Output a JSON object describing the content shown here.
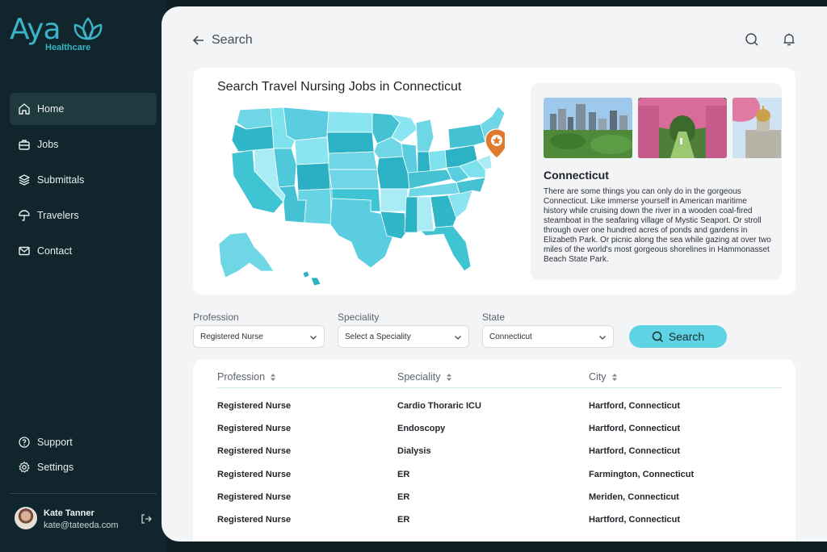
{
  "brand": {
    "name": "Aya",
    "sub": "Healthcare"
  },
  "sidebar": {
    "items": [
      {
        "label": "Home",
        "icon": "home-icon",
        "active": true
      },
      {
        "label": "Jobs",
        "icon": "briefcase-icon"
      },
      {
        "label": "Submittals",
        "icon": "layers-icon"
      },
      {
        "label": "Travelers",
        "icon": "umbrella-icon"
      },
      {
        "label": "Contact",
        "icon": "mail-icon"
      }
    ],
    "bottom": [
      {
        "label": "Support",
        "icon": "help-icon"
      },
      {
        "label": "Settings",
        "icon": "gear-icon"
      }
    ],
    "user": {
      "name": "Kate Tanner",
      "email": "kate@tateeda.com"
    }
  },
  "header": {
    "back_label": "Search"
  },
  "hero": {
    "title": "Search Travel Nursing Jobs in Connecticut",
    "info_title": "Connecticut",
    "info_text": "There are some things you can only do in the gorgeous Connecticut. Like immerse yourself in American maritime history while cruising down the river in a wooden coal-fired steamboat in the seafaring village of Mystic Seaport. Or stroll through over one hundred acres of ponds and gardens in Elizabeth Park. Or picnic along the sea while gazing at over two miles of the world's most gorgeous shorelines in Hammonasset Beach State Park."
  },
  "filters": {
    "profession": {
      "label": "Profession",
      "value": "Registered Nurse"
    },
    "speciality": {
      "label": "Speciality",
      "value": "Select a Speciality"
    },
    "state": {
      "label": "State",
      "value": "Connecticut"
    },
    "search_label": "Search"
  },
  "table": {
    "headers": [
      "Profession",
      "Speciality",
      "City"
    ],
    "rows": [
      [
        "Registered Nurse",
        "Cardio Thoraric ICU",
        "Hartford, Connecticut"
      ],
      [
        "Registered Nurse",
        "Endoscopy",
        "Hartford, Connecticut"
      ],
      [
        "Registered Nurse",
        "Dialysis",
        "Hartford, Connecticut"
      ],
      [
        "Registered Nurse",
        "ER",
        "Farmington, Connecticut"
      ],
      [
        "Registered Nurse",
        "ER",
        "Meriden, Connecticut"
      ],
      [
        "Registered Nurse",
        "ER",
        "Hartford, Connecticut"
      ]
    ]
  },
  "colors": {
    "accent": "#5ed3e3",
    "sidebar": "#10262c",
    "brand": "#3ab3c9",
    "pin": "#e07a2f"
  }
}
